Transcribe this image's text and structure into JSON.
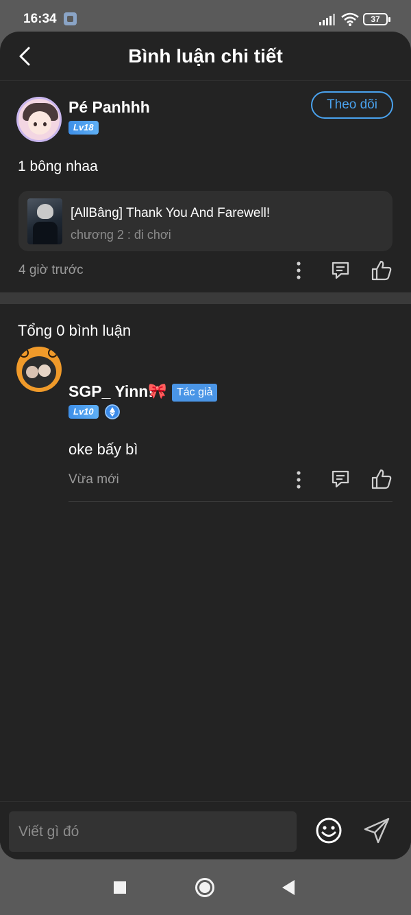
{
  "status_bar": {
    "time": "16:34",
    "battery": "37",
    "notification_icon": "screenshot-notification-icon",
    "signal_icon": "cellular-signal-icon",
    "wifi_icon": "wifi-icon"
  },
  "header": {
    "title": "Bình luận chi tiết",
    "back_icon": "chevron-left-icon"
  },
  "post": {
    "username": "Pé Panhhh",
    "level": "Lv18",
    "follow_label": "Theo dõi",
    "text": "1 bông nhaa",
    "story": {
      "title": "[AllBâng] Thank You And Farewell!",
      "chapter": "chương 2 : đi chơi"
    },
    "time": "4 giờ trước"
  },
  "comments": {
    "total_label": "Tổng 0 bình luận",
    "items": [
      {
        "username": "SGP_ Yinn!",
        "emoji": "🎀",
        "author_badge": "Tác giả",
        "level": "Lv10",
        "text": "oke bấy bì",
        "time": "Vừa mới"
      }
    ]
  },
  "composer": {
    "placeholder": "Viết gì đó",
    "emoji_icon": "smiley-icon",
    "send_icon": "send-icon"
  },
  "colors": {
    "background": "#232323",
    "accent": "#4aa3ef",
    "card": "#2f2f2f",
    "muted_text": "#9a9a9a"
  }
}
